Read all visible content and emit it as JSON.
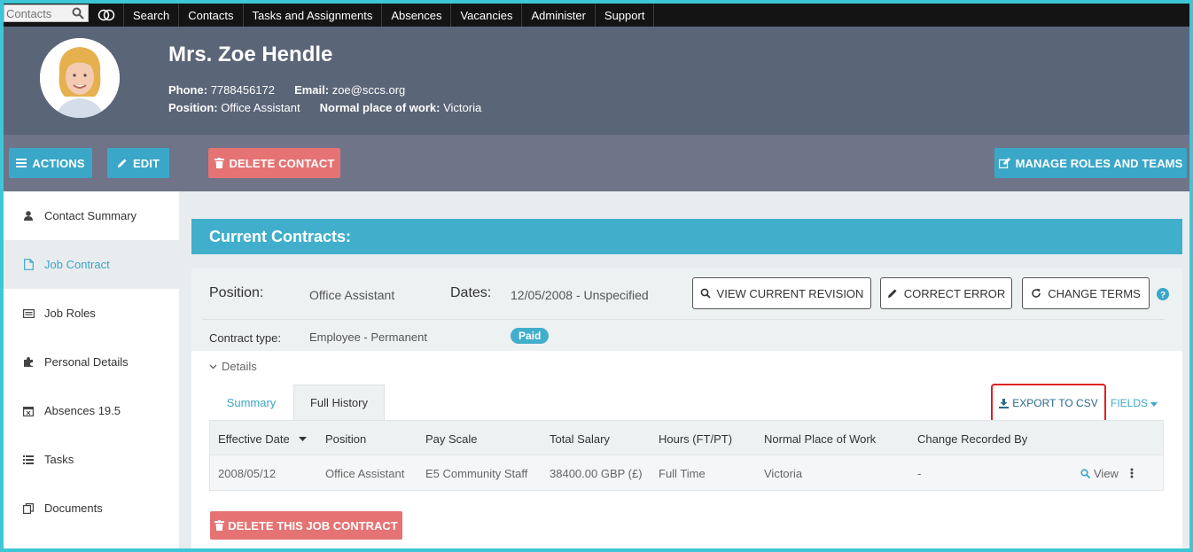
{
  "topnav": {
    "search_placeholder": "Contacts",
    "items": [
      "Search",
      "Contacts",
      "Tasks and Assignments",
      "Absences",
      "Vacancies",
      "Administer",
      "Support"
    ]
  },
  "contact": {
    "name": "Mrs. Zoe Hendle",
    "phone_label": "Phone:",
    "phone": "7788456172",
    "email_label": "Email:",
    "email": "zoe@sccs.org",
    "position_label": "Position:",
    "position": "Office Assistant",
    "workplace_label": "Normal place of work:",
    "workplace": "Victoria"
  },
  "actions": {
    "actions_label": "Actions",
    "edit_label": "Edit",
    "delete_label": "Delete Contact",
    "manage_label": "Manage Roles and Teams"
  },
  "sidebar": {
    "items": [
      {
        "label": "Contact Summary",
        "icon": "user-icon"
      },
      {
        "label": "Job Contract",
        "icon": "document-icon"
      },
      {
        "label": "Job Roles",
        "icon": "id-card-icon"
      },
      {
        "label": "Personal Details",
        "icon": "puzzle-icon"
      },
      {
        "label": "Absences 19.5",
        "icon": "calendar-icon"
      },
      {
        "label": "Tasks",
        "icon": "list-icon"
      },
      {
        "label": "Documents",
        "icon": "documents-icon"
      }
    ]
  },
  "contracts": {
    "banner_title": "Current Contracts:",
    "position_label": "Position:",
    "position_value": "Office Assistant",
    "dates_label": "Dates:",
    "dates_value": "12/05/2008 - Unspecified",
    "contract_type_label": "Contract type:",
    "contract_type_value": "Employee - Permanent",
    "paid_badge": "Paid",
    "view_revision_label": "View Current Revision",
    "correct_error_label": "Correct Error",
    "change_terms_label": "Change Terms",
    "details_label": "Details",
    "tabs": [
      "Summary",
      "Full History"
    ],
    "active_tab": "Full History",
    "export_label": "Export to CSV",
    "fields_label": "Fields",
    "columns": [
      "Effective Date",
      "Position",
      "Pay Scale",
      "Total Salary",
      "Hours (FT/PT)",
      "Normal Place of Work",
      "Change Recorded By"
    ],
    "rows": [
      [
        "2008/05/12",
        "Office Assistant",
        "E5 Community Staff",
        "38400.00 GBP (£)",
        "Full Time",
        "Victoria",
        "-"
      ]
    ],
    "view_label": "View",
    "delete_contract_label": "Delete this Job Contract"
  },
  "colors": {
    "accent": "#41afcc",
    "danger": "#e57373",
    "header_bg": "#5b6578"
  }
}
